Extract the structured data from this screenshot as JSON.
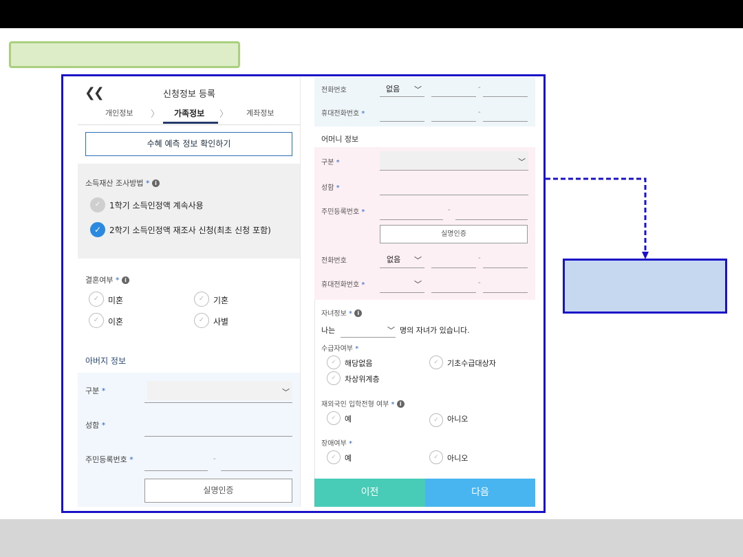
{
  "header": {
    "back_icon": "double-chevron-left-icon",
    "title": "신청정보 등록"
  },
  "steps": [
    {
      "label": "개인정보",
      "active": false
    },
    {
      "label": "가족정보",
      "active": true
    },
    {
      "label": "계좌정보",
      "active": false
    }
  ],
  "confirm_button": "수혜 예측 정보 확인하기",
  "income_method": {
    "label": "소득재산 조사방법",
    "required": "*",
    "options": [
      {
        "label": "1학기 소득인정액 계속사용",
        "checked": false
      },
      {
        "label": "2학기 소득인정액 재조사 신청(최초 신청 포함)",
        "checked": true
      }
    ]
  },
  "marriage": {
    "label": "결혼여부",
    "required": "*",
    "options": [
      "미혼",
      "기혼",
      "이혼",
      "사별"
    ]
  },
  "father": {
    "title": "아버지 정보",
    "type_label": "구분",
    "name_label": "성함",
    "rrn_label": "주민등록번호",
    "required": "*",
    "dash": "-",
    "realname_button": "실명인증"
  },
  "father_phone": {
    "phone_label": "전화번호",
    "phone_select": "없음",
    "mobile_label": "휴대전화번호",
    "required": "*",
    "dash": "-"
  },
  "mother": {
    "title": "어머니 정보",
    "type_label": "구분",
    "name_label": "성함",
    "rrn_label": "주민등록번호",
    "required": "*",
    "dash": "-",
    "realname_button": "실명인증",
    "phone_label": "전화번호",
    "phone_select": "없음",
    "mobile_label": "휴대전화번호"
  },
  "children": {
    "label": "자녀정보",
    "required": "*",
    "prefix": "나는",
    "suffix": "명의 자녀가 있습니다.",
    "recipient_label": "수급자여부",
    "recipient_options": [
      "해당없음",
      "기초수급대상자",
      "차상위계층"
    ],
    "overseas_label": "재외국인 입학전형 여부",
    "overseas_options": [
      "예",
      "아니오"
    ],
    "disability_label": "장애여부",
    "disability_options": [
      "예",
      "아니오"
    ]
  },
  "nav": {
    "prev": "이전",
    "next": "다음"
  },
  "colors": {
    "frame": "#1a12c9",
    "check": "#2b8ae0",
    "prev": "#48ccb8",
    "next": "#48b4f0",
    "green_box": "#dcedc8",
    "blue_box": "#c6d7f0"
  }
}
